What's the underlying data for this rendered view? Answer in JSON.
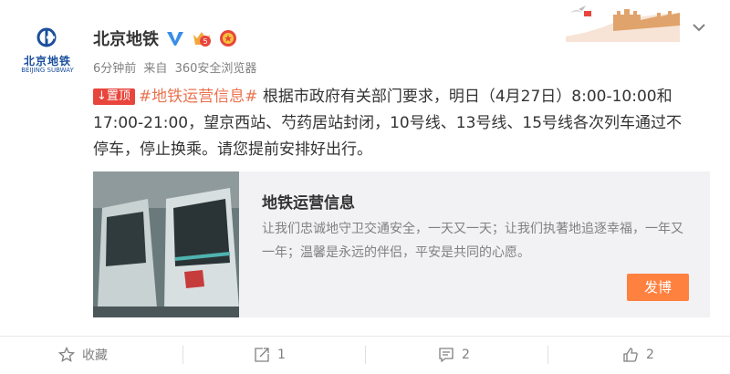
{
  "account": {
    "name": "北京地铁",
    "logo_text": "北京地铁",
    "logo_sub": "BEIJING SUBWAY",
    "time_ago": "6分钟前",
    "source_prefix": "来自",
    "source": "360安全浏览器"
  },
  "post": {
    "pin_label": "置顶",
    "topic": "#地铁运营信息#",
    "text": " 根据市政府有关部门要求，明日（4月27日）8:00-10:00和17:00-21:00，望京西站、芍药居站封闭，10号线、13号线、15号线各次列车通过不停车，停止换乘。请您提前安排好出行。"
  },
  "card": {
    "title": "地铁运营信息",
    "desc": "让我们忠诚地守卫交通安全，一天又一天；让我们执著地追逐幸福，一年又一年；温馨是永远的伴侣，平安是共同的心愿。",
    "button": "发博"
  },
  "footer": {
    "favorite_label": "收藏",
    "repost_count": "1",
    "comment_count": "2",
    "like_count": "2"
  },
  "colors": {
    "accent": "#eb7350",
    "pin": "#e8453c",
    "button": "#ff8140",
    "logo": "#1a4f9c"
  }
}
